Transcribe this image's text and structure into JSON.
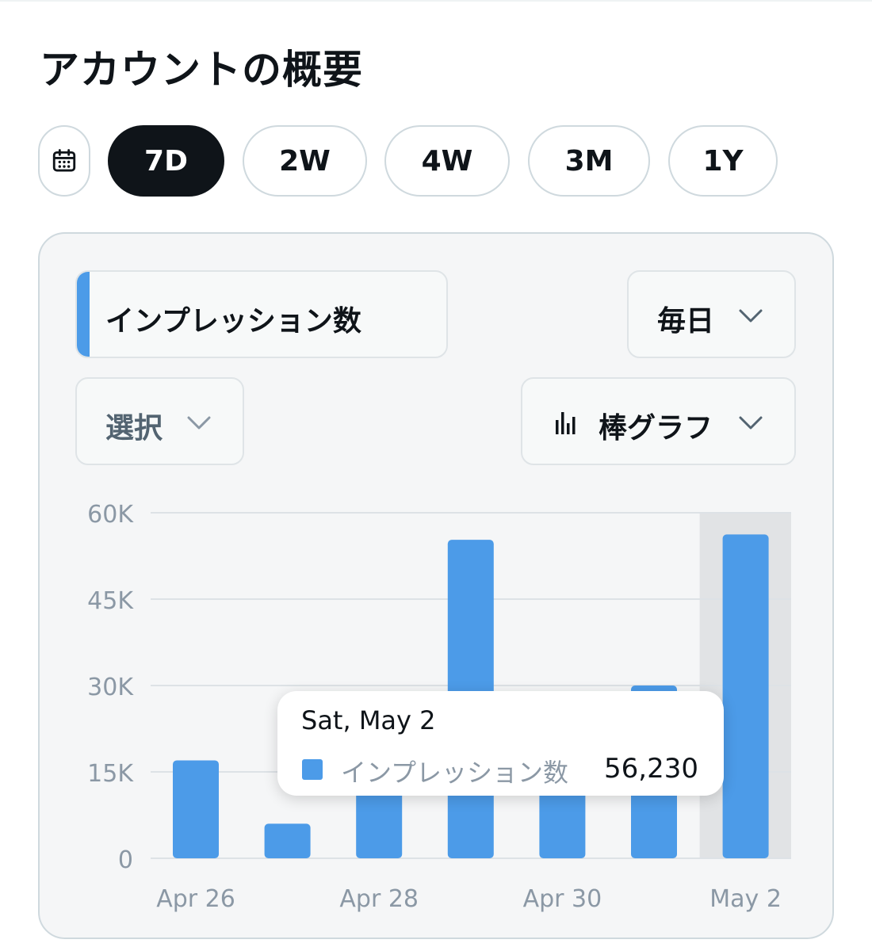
{
  "page": {
    "title": "アカウントの概要"
  },
  "range": {
    "calendar_icon": "calendar-icon",
    "options": [
      "7D",
      "2W",
      "4W",
      "3M",
      "1Y"
    ],
    "selected": "7D"
  },
  "controls": {
    "metric": "インプレッション数",
    "interval": "毎日",
    "compare": "選択",
    "chart_type": "棒グラフ",
    "chart_type_icon": "bar-chart-icon",
    "accent_color": "#4c9be8"
  },
  "tooltip": {
    "title": "Sat, May 2",
    "label": "インプレッション数",
    "value": "56,230"
  },
  "chart_data": {
    "type": "bar",
    "categories": [
      "Apr 26",
      "Apr 27",
      "Apr 28",
      "Apr 29",
      "Apr 30",
      "May 1",
      "May 2"
    ],
    "x_tick_labels": [
      "Apr 26",
      "",
      "Apr 28",
      "",
      "Apr 30",
      "",
      "May 2"
    ],
    "series": [
      {
        "values": [
          17000,
          6000,
          13500,
          55300,
          13500,
          30000,
          56230
        ],
        "color": "#4c9be8"
      }
    ],
    "y_ticks": [
      0,
      15000,
      30000,
      45000,
      60000
    ],
    "y_tick_labels": [
      "0",
      "15K",
      "30K",
      "45K",
      "60K"
    ],
    "ylim": [
      0,
      60000
    ],
    "highlighted_category": "May 2",
    "grid": true,
    "xlabel": "",
    "ylabel": "",
    "title": ""
  }
}
